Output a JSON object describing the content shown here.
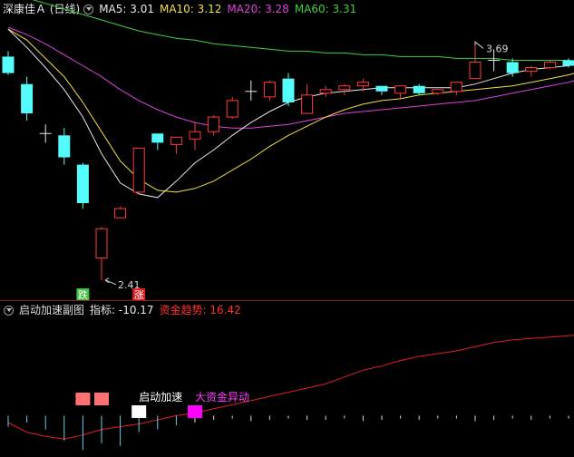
{
  "main_header": {
    "title": "深康佳Ａ (日线)",
    "ma": [
      {
        "label": "MA5: 3.01",
        "color": "#e8e8e8"
      },
      {
        "label": "MA10: 3.12",
        "color": "#f0e040"
      },
      {
        "label": "MA20: 3.28",
        "color": "#e040e0"
      },
      {
        "label": "MA60: 3.31",
        "color": "#40d040"
      }
    ]
  },
  "sub_header": {
    "title": "启动加速副图",
    "indicator_label": "指标: -10.17",
    "trend_label": "资金趋势: 16.42",
    "indicator_color": "#e8e8e8",
    "trend_color": "#ff3030"
  },
  "colors": {
    "up": "#ff3a3a",
    "down": "#54fcfc",
    "flat": "#e8e8e8",
    "ma5": "#e8e8e8",
    "ma10": "#f0e040",
    "ma20": "#e040e0",
    "ma60": "#40d040",
    "trend": "#e02020",
    "bar": "#6ad0e8"
  },
  "chart_data": [
    {
      "type": "candlestick",
      "y_range": [
        2.33,
        3.84
      ],
      "candles": [
        {
          "o": 3.63,
          "h": 3.66,
          "l": 3.53,
          "c": 3.54
        },
        {
          "o": 3.48,
          "h": 3.52,
          "l": 3.28,
          "c": 3.32
        },
        {
          "o": 3.21,
          "h": 3.26,
          "l": 3.16,
          "c": 3.21
        },
        {
          "o": 3.2,
          "h": 3.24,
          "l": 3.04,
          "c": 3.08
        },
        {
          "o": 3.04,
          "h": 3.05,
          "l": 2.8,
          "c": 2.83
        },
        {
          "o": 2.53,
          "h": 2.7,
          "l": 2.41,
          "c": 2.69
        },
        {
          "o": 2.75,
          "h": 2.81,
          "l": 2.75,
          "c": 2.8
        },
        {
          "o": 2.89,
          "h": 3.13,
          "l": 2.88,
          "c": 3.13
        },
        {
          "o": 3.21,
          "h": 3.21,
          "l": 3.12,
          "c": 3.16
        },
        {
          "o": 3.15,
          "h": 3.19,
          "l": 3.1,
          "c": 3.19
        },
        {
          "o": 3.18,
          "h": 3.27,
          "l": 3.12,
          "c": 3.22
        },
        {
          "o": 3.22,
          "h": 3.31,
          "l": 3.2,
          "c": 3.3
        },
        {
          "o": 3.3,
          "h": 3.41,
          "l": 3.29,
          "c": 3.39
        },
        {
          "o": 3.44,
          "h": 3.5,
          "l": 3.39,
          "c": 3.44
        },
        {
          "o": 3.41,
          "h": 3.5,
          "l": 3.39,
          "c": 3.49
        },
        {
          "o": 3.51,
          "h": 3.54,
          "l": 3.36,
          "c": 3.38
        },
        {
          "o": 3.32,
          "h": 3.48,
          "l": 3.32,
          "c": 3.42
        },
        {
          "o": 3.43,
          "h": 3.47,
          "l": 3.41,
          "c": 3.45
        },
        {
          "o": 3.45,
          "h": 3.48,
          "l": 3.42,
          "c": 3.47
        },
        {
          "o": 3.47,
          "h": 3.51,
          "l": 3.44,
          "c": 3.49
        },
        {
          "o": 3.47,
          "h": 3.47,
          "l": 3.42,
          "c": 3.44
        },
        {
          "o": 3.43,
          "h": 3.47,
          "l": 3.4,
          "c": 3.47
        },
        {
          "o": 3.47,
          "h": 3.48,
          "l": 3.42,
          "c": 3.43
        },
        {
          "o": 3.43,
          "h": 3.45,
          "l": 3.42,
          "c": 3.45
        },
        {
          "o": 3.44,
          "h": 3.49,
          "l": 3.42,
          "c": 3.49
        },
        {
          "o": 3.51,
          "h": 3.69,
          "l": 3.51,
          "c": 3.6
        },
        {
          "o": 3.61,
          "h": 3.67,
          "l": 3.55,
          "c": 3.61
        },
        {
          "o": 3.6,
          "h": 3.62,
          "l": 3.52,
          "c": 3.54
        },
        {
          "o": 3.55,
          "h": 3.58,
          "l": 3.52,
          "c": 3.57
        },
        {
          "o": 3.57,
          "h": 3.61,
          "l": 3.56,
          "c": 3.6
        },
        {
          "o": 3.61,
          "h": 3.62,
          "l": 3.57,
          "c": 3.58
        },
        {
          "o": 3.59,
          "h": 3.61,
          "l": 3.58,
          "c": 3.6
        }
      ],
      "ma5": [
        3.78,
        3.68,
        3.57,
        3.45,
        3.3,
        3.1,
        2.94,
        2.88,
        2.86,
        2.95,
        3.05,
        3.12,
        3.2,
        3.27,
        3.33,
        3.38,
        3.41,
        3.43,
        3.44,
        3.45,
        3.46,
        3.46,
        3.46,
        3.46,
        3.46,
        3.48,
        3.51,
        3.54,
        3.56,
        3.57,
        3.58,
        3.6
      ],
      "ma10": [
        3.78,
        3.72,
        3.62,
        3.52,
        3.38,
        3.22,
        3.06,
        2.96,
        2.9,
        2.89,
        2.91,
        2.95,
        3.01,
        3.07,
        3.14,
        3.2,
        3.25,
        3.3,
        3.34,
        3.37,
        3.39,
        3.4,
        3.42,
        3.43,
        3.44,
        3.45,
        3.46,
        3.47,
        3.49,
        3.51,
        3.53,
        3.56
      ],
      "ma20": [
        3.79,
        3.75,
        3.7,
        3.64,
        3.58,
        3.52,
        3.45,
        3.39,
        3.34,
        3.3,
        3.27,
        3.25,
        3.24,
        3.24,
        3.25,
        3.26,
        3.28,
        3.3,
        3.32,
        3.33,
        3.34,
        3.35,
        3.36,
        3.37,
        3.38,
        3.39,
        3.41,
        3.43,
        3.45,
        3.47,
        3.49,
        3.52
      ],
      "ma60": [
        3.98,
        3.95,
        3.92,
        3.89,
        3.86,
        3.83,
        3.8,
        3.77,
        3.75,
        3.73,
        3.72,
        3.7,
        3.69,
        3.68,
        3.67,
        3.66,
        3.66,
        3.65,
        3.65,
        3.64,
        3.64,
        3.63,
        3.63,
        3.63,
        3.62,
        3.62,
        3.62,
        3.61,
        3.61,
        3.61,
        3.61,
        3.6
      ],
      "annotations": [
        {
          "text": "3.69",
          "index": 25,
          "value": 3.69,
          "kind": "high"
        },
        {
          "text": "2.41",
          "index": 5,
          "value": 2.41,
          "kind": "low"
        }
      ],
      "signals": [
        {
          "text": "跌",
          "index": 4,
          "color": "#40c040"
        },
        {
          "text": "涨",
          "index": 7,
          "color": "#e02020"
        }
      ]
    },
    {
      "type": "indicator",
      "y_range": [
        0,
        100
      ],
      "baseline": 30,
      "trend": [
        25,
        18,
        15,
        13,
        16,
        20,
        22,
        24,
        27,
        30,
        32,
        35,
        38,
        41,
        44,
        47,
        50,
        53,
        58,
        63,
        66,
        70,
        73,
        75,
        77,
        80,
        83,
        85,
        86,
        87,
        88,
        89
      ],
      "bars": [
        -8,
        -5,
        -10,
        -18,
        -25,
        -20,
        -22,
        -12,
        -10,
        -7,
        -5,
        -3,
        -2,
        -4,
        -3,
        -2,
        -3,
        -3,
        -2,
        -4,
        -3,
        -2,
        -3,
        -2,
        -2,
        -4,
        -3,
        -2,
        -3,
        -2,
        -2,
        -2
      ],
      "markers": [
        {
          "index": 4,
          "color": "#ff7070"
        },
        {
          "index": 5,
          "color": "#ff7070"
        },
        {
          "index": 7,
          "color": "#ffffff",
          "label": "启动加速",
          "label_color": "#ffffff"
        },
        {
          "index": 10,
          "color": "#ff00ff",
          "label": "大资金异动",
          "label_color": "#ff40ff"
        }
      ]
    }
  ]
}
